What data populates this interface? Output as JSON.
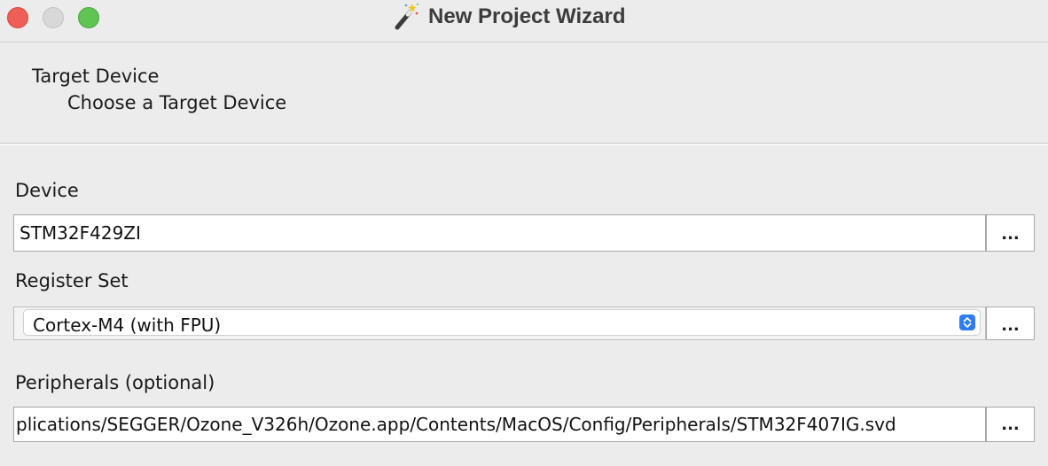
{
  "window": {
    "title": "New Project Wizard",
    "icon": "magic-wand-icon"
  },
  "header": {
    "step_title": "Target Device",
    "step_subtitle": "Choose a Target Device"
  },
  "device": {
    "label": "Device",
    "value": "STM32F429ZI",
    "browse_label": "..."
  },
  "register_set": {
    "label": "Register Set",
    "selected": "Cortex-M4 (with FPU)",
    "browse_label": "..."
  },
  "peripherals": {
    "label": "Peripherals (optional)",
    "value": "plications/SEGGER/Ozone_V326h/Ozone.app/Contents/MacOS/Config/Peripherals/STM32F407IG.svd",
    "browse_label": "..."
  },
  "colors": {
    "close": "#ee5f57",
    "maximize": "#5fc454",
    "select_accent": "#2f7cf6"
  }
}
